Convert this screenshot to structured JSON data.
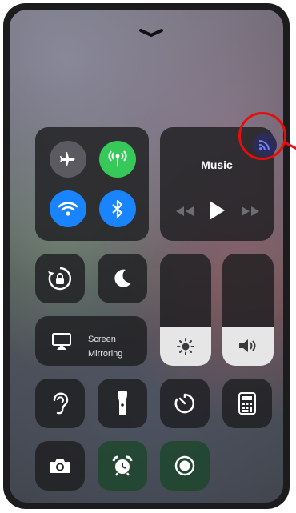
{
  "control_center": {
    "music": {
      "title": "Music"
    },
    "screen_mirroring": {
      "line1": "Screen",
      "line2": "Mirroring"
    }
  },
  "sliders": {
    "brightness_level": 0.35,
    "volume_level": 0.35
  },
  "colors": {
    "cellular_on": "#37c85a",
    "wifi_on": "#1a84ff",
    "bluetooth_on": "#1a84ff",
    "callout": "#e50e0e"
  },
  "icons": [
    "chevron-down-icon",
    "airplane-icon",
    "cellular-icon",
    "wifi-icon",
    "bluetooth-icon",
    "airplay-icon",
    "rewind-icon",
    "play-icon",
    "fast-forward-icon",
    "rotation-lock-icon",
    "moon-icon",
    "screen-mirroring-icon",
    "brightness-icon",
    "volume-icon",
    "hearing-icon",
    "flashlight-icon",
    "timer-icon",
    "calculator-icon",
    "camera-icon",
    "alarm-icon",
    "record-icon"
  ]
}
